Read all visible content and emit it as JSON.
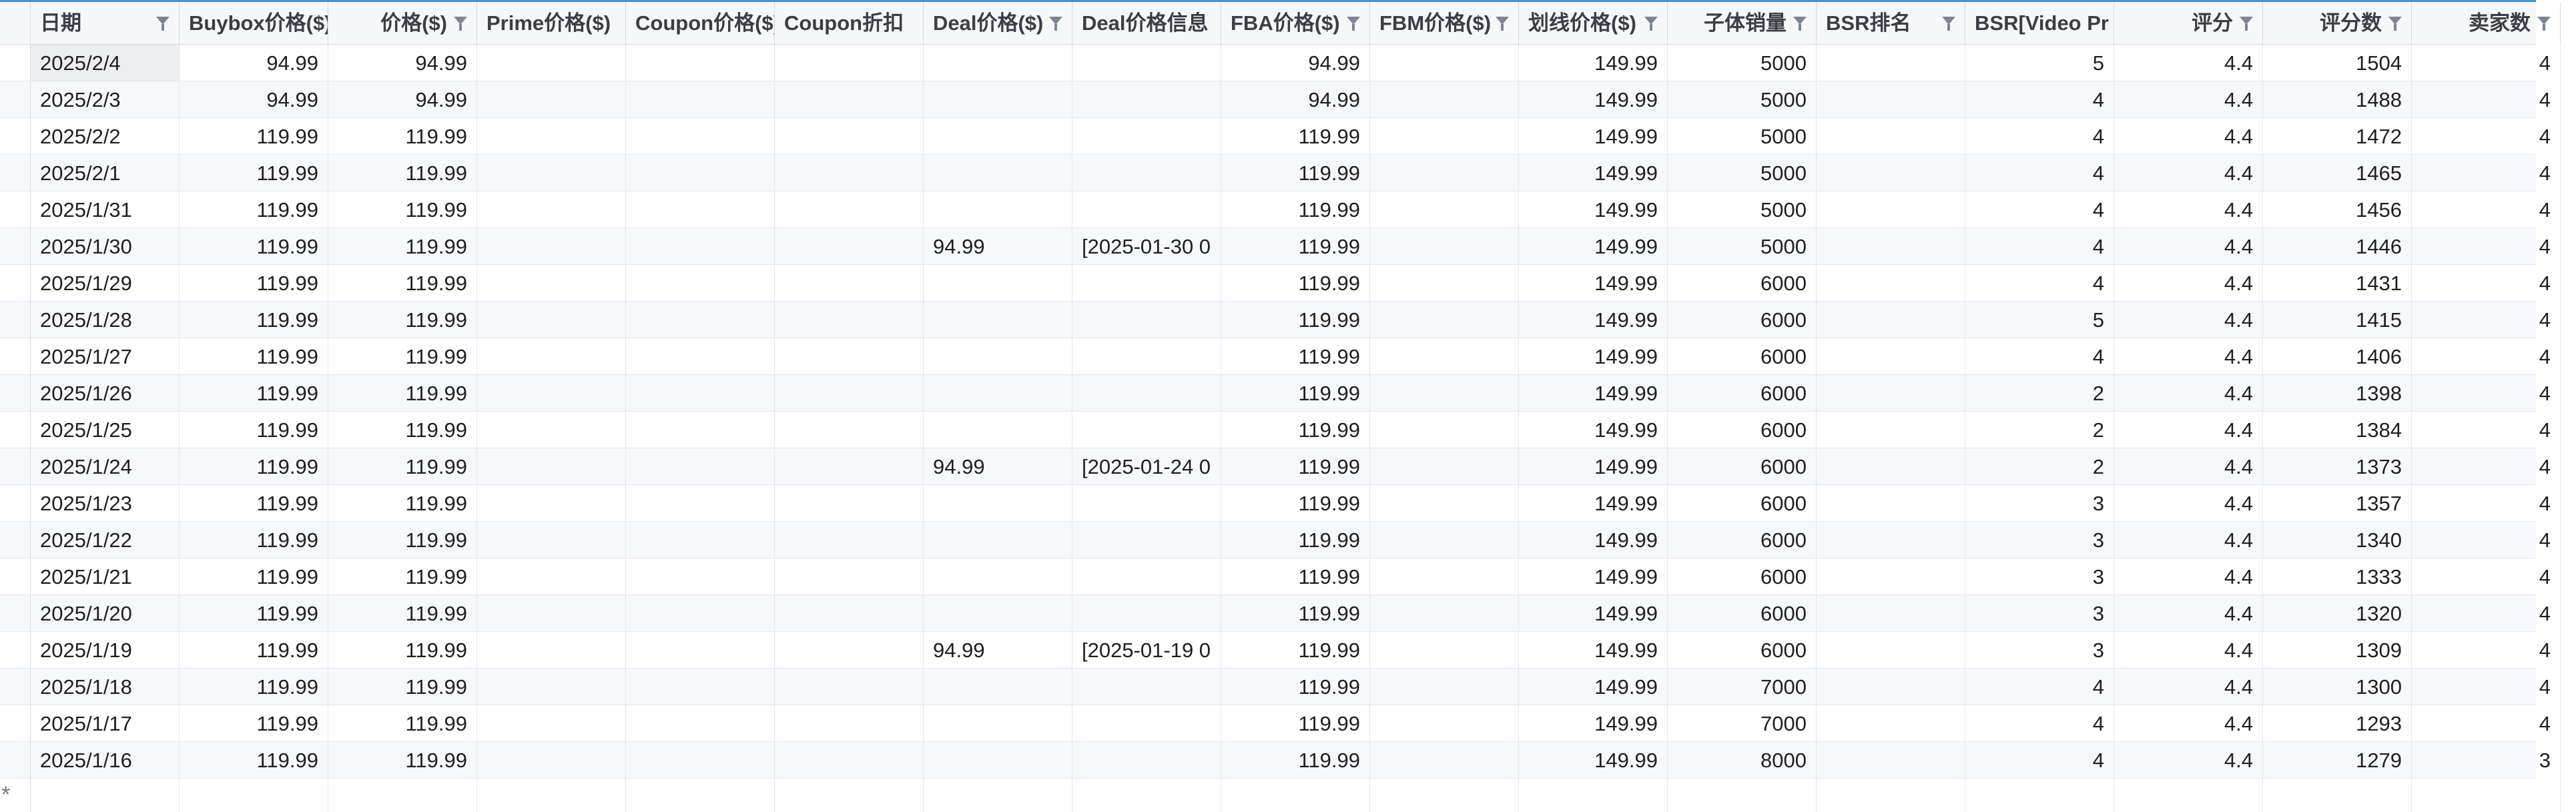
{
  "columns": [
    {
      "label": "日期",
      "align": "left",
      "filter": true
    },
    {
      "label": "Buybox价格($)",
      "align": "right",
      "filter": false
    },
    {
      "label": "价格($)",
      "align": "right",
      "filter": true
    },
    {
      "label": "Prime价格($)",
      "align": "left",
      "filter": false
    },
    {
      "label": "Coupon价格($)",
      "align": "left",
      "filter": false
    },
    {
      "label": "Coupon折扣",
      "align": "left",
      "filter": false
    },
    {
      "label": "Deal价格($)",
      "align": "left",
      "filter": true
    },
    {
      "label": "Deal价格信息",
      "align": "left",
      "filter": false
    },
    {
      "label": "FBA价格($)",
      "align": "left",
      "filter": true
    },
    {
      "label": "FBM价格($)",
      "align": "left",
      "filter": true
    },
    {
      "label": "划线价格($)",
      "align": "left",
      "filter": true
    },
    {
      "label": "子体销量",
      "align": "right",
      "filter": true
    },
    {
      "label": "BSR排名",
      "align": "left",
      "filter": true
    },
    {
      "label": "BSR[Video Pr",
      "align": "left",
      "filter": false
    },
    {
      "label": "评分",
      "align": "right",
      "filter": true
    },
    {
      "label": "评分数",
      "align": "right",
      "filter": true
    },
    {
      "label": "卖家数",
      "align": "right",
      "filter": true
    }
  ],
  "rows": [
    [
      "2025/2/4",
      "94.99",
      "94.99",
      "",
      "",
      "",
      "",
      "",
      "94.99",
      "",
      "149.99",
      "5000",
      "",
      "5",
      "4.4",
      "1504",
      "4"
    ],
    [
      "2025/2/3",
      "94.99",
      "94.99",
      "",
      "",
      "",
      "",
      "",
      "94.99",
      "",
      "149.99",
      "5000",
      "",
      "4",
      "4.4",
      "1488",
      "4"
    ],
    [
      "2025/2/2",
      "119.99",
      "119.99",
      "",
      "",
      "",
      "",
      "",
      "119.99",
      "",
      "149.99",
      "5000",
      "",
      "4",
      "4.4",
      "1472",
      "4"
    ],
    [
      "2025/2/1",
      "119.99",
      "119.99",
      "",
      "",
      "",
      "",
      "",
      "119.99",
      "",
      "149.99",
      "5000",
      "",
      "4",
      "4.4",
      "1465",
      "4"
    ],
    [
      "2025/1/31",
      "119.99",
      "119.99",
      "",
      "",
      "",
      "",
      "",
      "119.99",
      "",
      "149.99",
      "5000",
      "",
      "4",
      "4.4",
      "1456",
      "4"
    ],
    [
      "2025/1/30",
      "119.99",
      "119.99",
      "",
      "",
      "",
      "94.99",
      "[2025-01-30 0",
      "119.99",
      "",
      "149.99",
      "5000",
      "",
      "4",
      "4.4",
      "1446",
      "4"
    ],
    [
      "2025/1/29",
      "119.99",
      "119.99",
      "",
      "",
      "",
      "",
      "",
      "119.99",
      "",
      "149.99",
      "6000",
      "",
      "4",
      "4.4",
      "1431",
      "4"
    ],
    [
      "2025/1/28",
      "119.99",
      "119.99",
      "",
      "",
      "",
      "",
      "",
      "119.99",
      "",
      "149.99",
      "6000",
      "",
      "5",
      "4.4",
      "1415",
      "4"
    ],
    [
      "2025/1/27",
      "119.99",
      "119.99",
      "",
      "",
      "",
      "",
      "",
      "119.99",
      "",
      "149.99",
      "6000",
      "",
      "4",
      "4.4",
      "1406",
      "4"
    ],
    [
      "2025/1/26",
      "119.99",
      "119.99",
      "",
      "",
      "",
      "",
      "",
      "119.99",
      "",
      "149.99",
      "6000",
      "",
      "2",
      "4.4",
      "1398",
      "4"
    ],
    [
      "2025/1/25",
      "119.99",
      "119.99",
      "",
      "",
      "",
      "",
      "",
      "119.99",
      "",
      "149.99",
      "6000",
      "",
      "2",
      "4.4",
      "1384",
      "4"
    ],
    [
      "2025/1/24",
      "119.99",
      "119.99",
      "",
      "",
      "",
      "94.99",
      "[2025-01-24 0",
      "119.99",
      "",
      "149.99",
      "6000",
      "",
      "2",
      "4.4",
      "1373",
      "4"
    ],
    [
      "2025/1/23",
      "119.99",
      "119.99",
      "",
      "",
      "",
      "",
      "",
      "119.99",
      "",
      "149.99",
      "6000",
      "",
      "3",
      "4.4",
      "1357",
      "4"
    ],
    [
      "2025/1/22",
      "119.99",
      "119.99",
      "",
      "",
      "",
      "",
      "",
      "119.99",
      "",
      "149.99",
      "6000",
      "",
      "3",
      "4.4",
      "1340",
      "4"
    ],
    [
      "2025/1/21",
      "119.99",
      "119.99",
      "",
      "",
      "",
      "",
      "",
      "119.99",
      "",
      "149.99",
      "6000",
      "",
      "3",
      "4.4",
      "1333",
      "4"
    ],
    [
      "2025/1/20",
      "119.99",
      "119.99",
      "",
      "",
      "",
      "",
      "",
      "119.99",
      "",
      "149.99",
      "6000",
      "",
      "3",
      "4.4",
      "1320",
      "4"
    ],
    [
      "2025/1/19",
      "119.99",
      "119.99",
      "",
      "",
      "",
      "94.99",
      "[2025-01-19 0",
      "119.99",
      "",
      "149.99",
      "6000",
      "",
      "3",
      "4.4",
      "1309",
      "4"
    ],
    [
      "2025/1/18",
      "119.99",
      "119.99",
      "",
      "",
      "",
      "",
      "",
      "119.99",
      "",
      "149.99",
      "7000",
      "",
      "4",
      "4.4",
      "1300",
      "4"
    ],
    [
      "2025/1/17",
      "119.99",
      "119.99",
      "",
      "",
      "",
      "",
      "",
      "119.99",
      "",
      "149.99",
      "7000",
      "",
      "4",
      "4.4",
      "1293",
      "4"
    ],
    [
      "2025/1/16",
      "119.99",
      "119.99",
      "",
      "",
      "",
      "",
      "",
      "119.99",
      "",
      "149.99",
      "8000",
      "",
      "4",
      "4.4",
      "1279",
      "3"
    ]
  ],
  "new_row_marker": "*",
  "accent_color": "#4a90c8"
}
